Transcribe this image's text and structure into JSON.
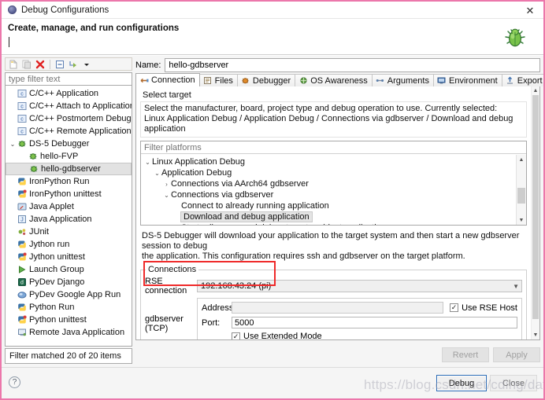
{
  "window": {
    "title": "Debug Configurations",
    "icon": "debug-dialog-icon",
    "close_label": "✕"
  },
  "header": {
    "title": "Create, manage, and run configurations",
    "subtitle": "",
    "bug_icon": "green-bug-icon"
  },
  "left_panel": {
    "toolbar": [
      {
        "name": "new-configuration-icon",
        "glyph": "□"
      },
      {
        "name": "duplicate-configuration-icon",
        "glyph": "▣"
      },
      {
        "name": "delete-configuration-icon",
        "glyph": "✖"
      },
      {
        "name": "collapse-all-icon",
        "glyph": "⊟"
      },
      {
        "name": "filter-icon",
        "glyph": "↳"
      },
      {
        "name": "view-menu-icon",
        "glyph": "▾"
      }
    ],
    "filter_placeholder": "type filter text",
    "filter_value": "",
    "tree": [
      {
        "label": "C/C++ Application",
        "level": 0,
        "icon": "c-app-icon",
        "twisty": "",
        "selected": false
      },
      {
        "label": "C/C++ Attach to Application",
        "level": 0,
        "icon": "c-app-icon",
        "twisty": "",
        "selected": false
      },
      {
        "label": "C/C++ Postmortem Debugger",
        "level": 0,
        "icon": "c-app-icon",
        "twisty": "",
        "selected": false
      },
      {
        "label": "C/C++ Remote Application",
        "level": 0,
        "icon": "c-app-icon",
        "twisty": "",
        "selected": false
      },
      {
        "label": "DS-5 Debugger",
        "level": 0,
        "icon": "ds5-icon",
        "twisty": "⌄",
        "selected": false
      },
      {
        "label": "hello-FVP",
        "level": 1,
        "icon": "ds5-icon",
        "twisty": "",
        "selected": false
      },
      {
        "label": "hello-gdbserver",
        "level": 1,
        "icon": "ds5-icon",
        "twisty": "",
        "selected": true
      },
      {
        "label": "IronPython Run",
        "level": 0,
        "icon": "python-run-icon",
        "twisty": "",
        "selected": false
      },
      {
        "label": "IronPython unittest",
        "level": 0,
        "icon": "python-test-icon",
        "twisty": "",
        "selected": false
      },
      {
        "label": "Java Applet",
        "level": 0,
        "icon": "java-applet-icon",
        "twisty": "",
        "selected": false
      },
      {
        "label": "Java Application",
        "level": 0,
        "icon": "java-app-icon",
        "twisty": "",
        "selected": false
      },
      {
        "label": "JUnit",
        "level": 0,
        "icon": "junit-icon",
        "twisty": "",
        "selected": false
      },
      {
        "label": "Jython run",
        "level": 0,
        "icon": "python-run-icon",
        "twisty": "",
        "selected": false
      },
      {
        "label": "Jython unittest",
        "level": 0,
        "icon": "python-test-icon",
        "twisty": "",
        "selected": false
      },
      {
        "label": "Launch Group",
        "level": 0,
        "icon": "launch-group-icon",
        "twisty": "",
        "selected": false
      },
      {
        "label": "PyDev Django",
        "level": 0,
        "icon": "django-icon",
        "twisty": "",
        "selected": false
      },
      {
        "label": "PyDev Google App Run",
        "level": 0,
        "icon": "gae-icon",
        "twisty": "",
        "selected": false
      },
      {
        "label": "Python Run",
        "level": 0,
        "icon": "python-run-icon",
        "twisty": "",
        "selected": false
      },
      {
        "label": "Python unittest",
        "level": 0,
        "icon": "python-test-icon",
        "twisty": "",
        "selected": false
      },
      {
        "label": "Remote Java Application",
        "level": 0,
        "icon": "remote-java-icon",
        "twisty": "",
        "selected": false
      }
    ],
    "status": "Filter matched 20 of 20 items"
  },
  "right_panel": {
    "name_label": "Name:",
    "name_value": "hello-gdbserver",
    "tabs": [
      {
        "label": "Connection",
        "icon": "connection-icon",
        "active": true
      },
      {
        "label": "Files",
        "icon": "files-icon",
        "active": false
      },
      {
        "label": "Debugger",
        "icon": "debugger-icon",
        "active": false
      },
      {
        "label": "OS Awareness",
        "icon": "os-awareness-icon",
        "active": false
      },
      {
        "label": "Arguments",
        "icon": "arguments-icon",
        "active": false
      },
      {
        "label": "Environment",
        "icon": "environment-icon",
        "active": false
      },
      {
        "label": "Export",
        "icon": "export-icon",
        "active": false
      }
    ],
    "select_target": {
      "heading": "Select target",
      "description_line1": "Select the manufacturer, board, project type and debug operation to use. Currently selected:",
      "description_line2": "Linux Application Debug / Application Debug / Connections via gdbserver / Download and debug application",
      "platform_filter_placeholder": "Filter platforms",
      "platform_filter_value": "",
      "platform_tree": [
        {
          "label": "Linux Application Debug",
          "level": 0,
          "twisty": "⌄",
          "selected": false
        },
        {
          "label": "Application Debug",
          "level": 1,
          "twisty": "⌄",
          "selected": false
        },
        {
          "label": "Connections via AArch64 gdbserver",
          "level": 2,
          "twisty": "›",
          "selected": false
        },
        {
          "label": "Connections via gdbserver",
          "level": 2,
          "twisty": "⌄",
          "selected": false
        },
        {
          "label": "Connect to already running application",
          "level": 3,
          "twisty": "",
          "selected": false
        },
        {
          "label": "Download and debug application",
          "level": 3,
          "twisty": "",
          "selected": true
        },
        {
          "label": "Start gdbserver and debug target-resident application",
          "level": 3,
          "twisty": "",
          "selected": false
        }
      ],
      "long_description_line1": "DS-5 Debugger will download your application to the target system and then start a new gdbserver session to debug",
      "long_description_line2": "the application. This configuration requires ssh and gdbserver on the target platform."
    },
    "connections": {
      "legend": "Connections",
      "rse_label": "RSE connection",
      "rse_value": "192.168.43.24 (pi)",
      "tcp_label": "gdbserver (TCP)",
      "address_label": "Address:",
      "address_value": "",
      "use_rse_host_label": "Use RSE Host",
      "use_rse_host_checked": true,
      "port_label": "Port:",
      "port_value": "5000",
      "use_extended_mode_label": "Use Extended Mode",
      "use_extended_mode_checked": true
    },
    "revert_label": "Revert",
    "apply_label": "Apply"
  },
  "footer": {
    "help_icon": "help-icon",
    "help_glyph": "?",
    "debug_label": "Debug",
    "close_label": "Close"
  },
  "watermark": "https://blog.csdn.net/cding/dafa",
  "colors": {
    "window_border": "#ec77ab",
    "highlight_box": "#ef2a2a",
    "selection": "#e2e2e2",
    "primary_button_border": "#2a6ab5"
  }
}
